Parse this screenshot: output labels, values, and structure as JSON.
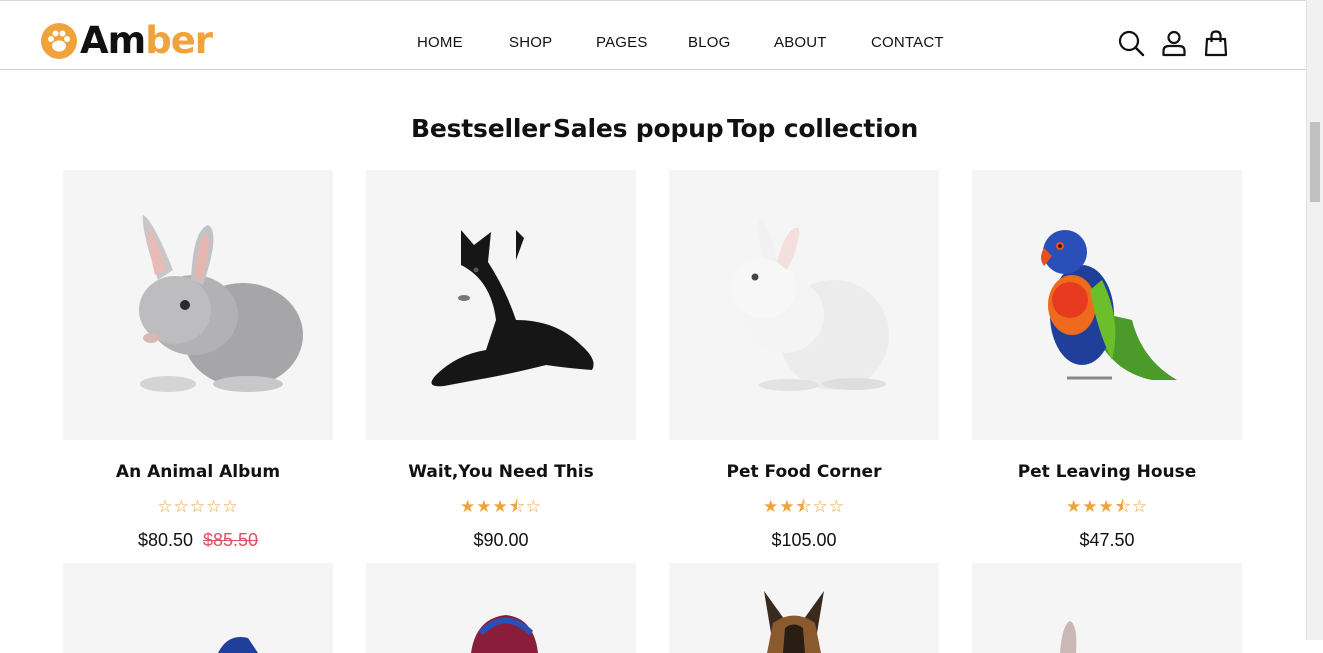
{
  "logo": {
    "text_main": "Am",
    "text_accent": "ber",
    "accent_color": "#f0a33a"
  },
  "nav": [
    "HOME",
    "SHOP",
    "PAGES",
    "BLOG",
    "ABOUT",
    "CONTACT"
  ],
  "header_icons": [
    "search-icon",
    "user-icon",
    "bag-icon"
  ],
  "tabs": [
    "Bestseller",
    "Sales popup",
    "Top collection"
  ],
  "products": [
    {
      "title": "An Animal Album",
      "rating": 0,
      "price": "$80.50",
      "old_price": "$85.50",
      "image": "grey-rabbit"
    },
    {
      "title": "Wait,You Need This",
      "rating": 3.5,
      "price": "$90.00",
      "old_price": "",
      "image": "black-dog"
    },
    {
      "title": "Pet Food Corner",
      "rating": 2.5,
      "price": "$105.00",
      "old_price": "",
      "image": "white-rabbit"
    },
    {
      "title": "Pet Leaving House",
      "rating": 3.5,
      "price": "$47.50",
      "old_price": "",
      "image": "parrot"
    }
  ],
  "colors": {
    "accent": "#f0a33a",
    "sale": "#e05060",
    "card_bg": "#f5f5f5"
  }
}
